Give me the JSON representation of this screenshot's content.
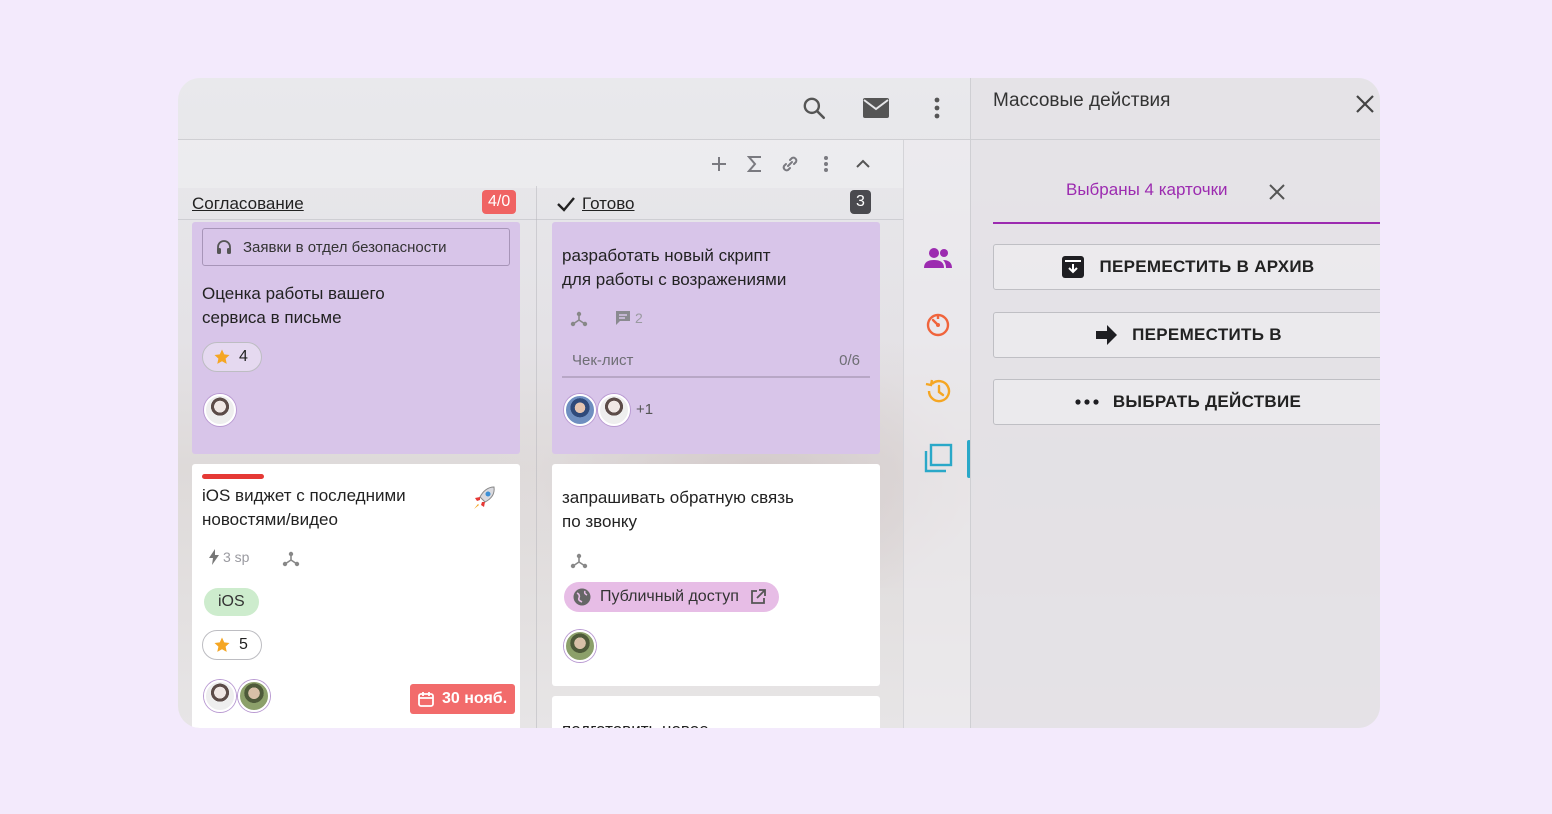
{
  "panel": {
    "title": "Массовые действия",
    "selection_text": "Выбраны 4 карточки",
    "actions": [
      {
        "label": "ПЕРЕМЕСТИТЬ В АРХИВ",
        "icon": "archive-icon"
      },
      {
        "label": "ПЕРЕМЕСТИТЬ В",
        "icon": "arrow-right-icon"
      },
      {
        "label": "ВЫБРАТЬ ДЕЙСТВИЕ",
        "icon": "more-horizontal-icon"
      }
    ],
    "accent_color": "#9c2bb0"
  },
  "columns": [
    {
      "title": "Согласование",
      "badge": "4/0",
      "badge_color": "#f06363",
      "cards": [
        {
          "tag": "Заявки в отдел безопасности",
          "title_line1": "Оценка работы вашего",
          "title_line2": "сервиса в письме",
          "rating": "4"
        },
        {
          "title_line1": "iOS виджет с последними",
          "title_line2": "новостями/видео",
          "story_points": "3 sp",
          "label": "iOS",
          "rating": "5",
          "due": "30 нояб."
        }
      ]
    },
    {
      "title": "Готово",
      "badge": "3",
      "badge_color": "#4a4a4f",
      "cards": [
        {
          "title_line1": "разработать новый скрипт",
          "title_line2": "для работы с возражениями",
          "comments": "2",
          "checklist_label": "Чек-лист",
          "checklist_progress": "0/6",
          "extra_members": "+1"
        },
        {
          "title_line1": "запрашивать обратную связь",
          "title_line2": "по звонку",
          "public_label": "Публичный доступ"
        },
        {
          "title_line1": "подготовить новое"
        }
      ]
    }
  ]
}
